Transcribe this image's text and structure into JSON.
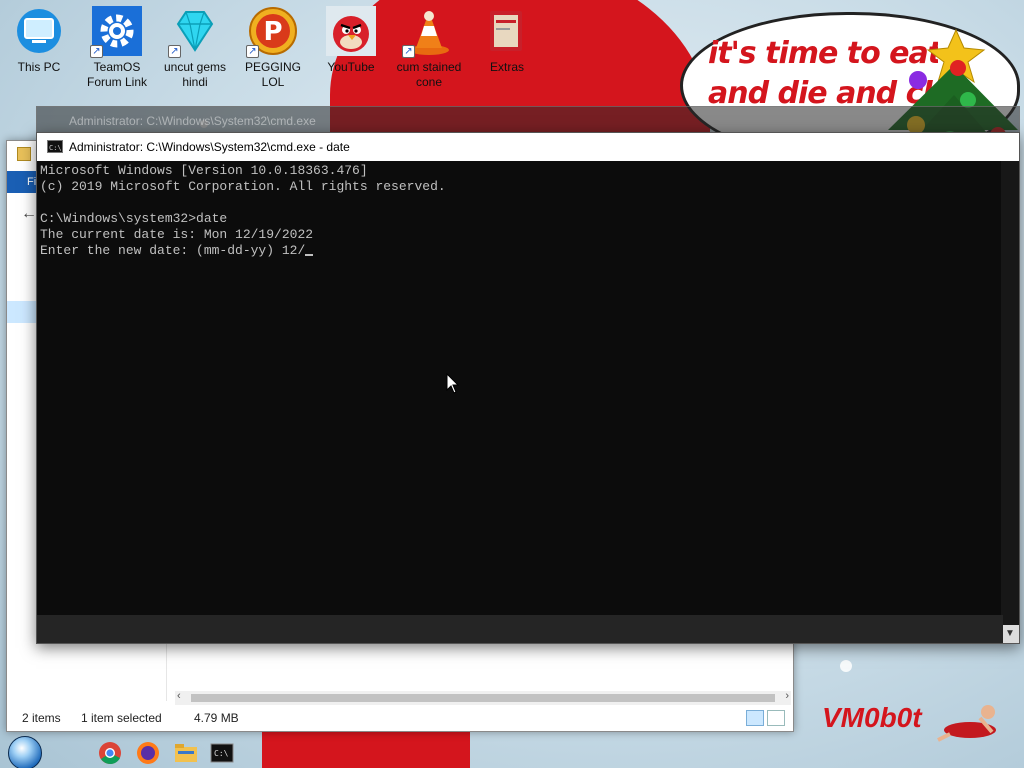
{
  "desktop": {
    "icons": [
      {
        "label": "This PC",
        "icon": "monitor-icon"
      },
      {
        "label": "TeamOS Forum Link",
        "icon": "gear-icon"
      },
      {
        "label": "uncut gems hindi",
        "icon": "diamond-icon"
      },
      {
        "label": "PEGGING LOL",
        "icon": "p-logo-icon"
      },
      {
        "label": "YouTube",
        "icon": "angry-bird-icon"
      },
      {
        "label": "cum stained cone",
        "icon": "traffic-cone-icon"
      },
      {
        "label": "Extras",
        "icon": "book-icon"
      }
    ],
    "speech_bubble": "it's time to eat\nand die and cl",
    "brand": "VM0b0t"
  },
  "cmd_ghost": {
    "title": "Administrator: C:\\Windows\\System32\\cmd.exe"
  },
  "cmd": {
    "title": "Administrator: C:\\Windows\\System32\\cmd.exe - date",
    "lines": [
      "Microsoft Windows [Version 10.0.18363.476]",
      "(c) 2019 Microsoft Corporation. All rights reserved.",
      "",
      "C:\\Windows\\system32>date",
      "The current date is: Mon 12/19/2022",
      "Enter the new date: (mm-dd-yy) 12/"
    ]
  },
  "explorer": {
    "ribbon_tab": "Fi",
    "status_items": "2 items",
    "status_selected": "1 item selected",
    "status_size": "4.79 MB"
  },
  "colors": {
    "accent_red": "#d4151d",
    "cmd_bg": "#0c0c0c",
    "cmd_text": "#c0c0c0",
    "ribbon_blue": "#1a5fb4"
  }
}
